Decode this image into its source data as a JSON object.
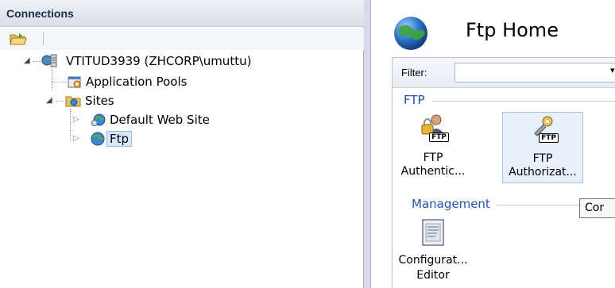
{
  "connections": {
    "title": "Connections",
    "tree": {
      "server": "VTITUD3939 (ZHCORP\\umuttu)",
      "app_pools": "Application Pools",
      "sites": "Sites",
      "default_site": "Default Web Site",
      "ftp_site": "Ftp"
    }
  },
  "main": {
    "title": "Ftp Home",
    "filter_label": "Filter:",
    "groups": {
      "ftp": "FTP",
      "management": "Management"
    },
    "tiles": {
      "ftp_auth": {
        "line1": "FTP",
        "line2": "Authentic..."
      },
      "ftp_authz": {
        "line1": "FTP",
        "line2": "Authorizat..."
      },
      "config_editor": {
        "line1": "Configurat...",
        "line2": "Editor"
      }
    },
    "ftp_badge": "FTP",
    "tooltip": "Cor"
  },
  "colors": {
    "group_label": "#1f53b4",
    "selection": "#d6e8fb"
  }
}
